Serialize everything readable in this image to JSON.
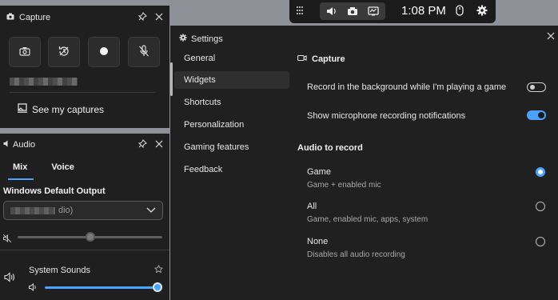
{
  "topbar": {
    "time": "1:08 PM",
    "icons": [
      "widget-menu-icon",
      "volume-icon",
      "camera-icon",
      "performance-icon",
      "mouse-icon",
      "gear-icon"
    ]
  },
  "capture_panel": {
    "title": "Capture",
    "see_captures": "See my captures",
    "buttons": [
      "screenshot-icon",
      "record-last-icon",
      "record-icon",
      "mic-off-icon"
    ]
  },
  "audio_panel": {
    "title": "Audio",
    "tabs": [
      "Mix",
      "Voice"
    ],
    "output_label": "Windows Default Output",
    "output_value_suffix": "dio)",
    "output_volume_pct": 50,
    "app": {
      "name": "System Sounds",
      "volume_pct": 100
    }
  },
  "settings": {
    "title": "Settings",
    "nav": [
      "General",
      "Widgets",
      "Shortcuts",
      "Personalization",
      "Gaming features",
      "Feedback"
    ],
    "active_nav": "Widgets",
    "capture_section": "Capture",
    "options": [
      {
        "label": "Record in the background while I'm playing a game",
        "enabled": false
      },
      {
        "label": "Show microphone recording notifications",
        "enabled": true
      }
    ],
    "audio_section": "Audio to record",
    "audio_choices": [
      {
        "label": "Game",
        "sub": "Game + enabled mic",
        "selected": true
      },
      {
        "label": "All",
        "sub": "Game, enabled mic, apps, system",
        "selected": false
      },
      {
        "label": "None",
        "sub": "Disables all audio recording",
        "selected": false
      }
    ]
  },
  "colors": {
    "accent": "#4aa3ff",
    "panel": "#1f1f1f",
    "desktop": "#8e9197"
  }
}
